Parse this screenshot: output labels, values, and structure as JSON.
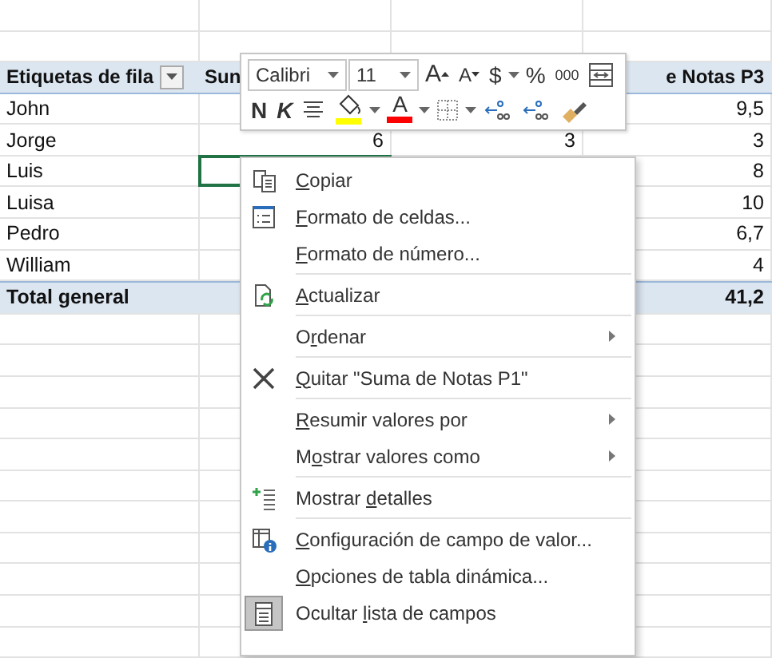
{
  "sheet": {
    "rows": [
      {
        "kind": "header",
        "label": "Etiquetas de fila",
        "filter": true,
        "column_2": "Sun",
        "column_4": "e Notas P3",
        "selected": false
      },
      {
        "kind": "item",
        "label": "John",
        "column_4": "9,5",
        "selected": false
      },
      {
        "kind": "item",
        "label": "Jorge",
        "column_2": "6",
        "column_3": "3",
        "column_4": "3",
        "selected": false
      },
      {
        "kind": "item",
        "label": "Luis",
        "column_4": "8",
        "selected": true
      },
      {
        "kind": "item",
        "label": "Luisa",
        "column_4": "10",
        "selected": false
      },
      {
        "kind": "item",
        "label": "Pedro",
        "column_4": "6,7",
        "selected": false
      },
      {
        "kind": "item",
        "label": "William",
        "column_4": "4",
        "selected": false
      },
      {
        "kind": "total",
        "label": "Total general",
        "column_4": "41,2",
        "selected": false
      }
    ]
  },
  "mini_toolbar": {
    "font": "Calibri",
    "size": "11",
    "row_1": [
      {
        "kind": "grow",
        "label": "A"
      },
      {
        "kind": "shrink",
        "label": "A"
      },
      {
        "kind": "text",
        "label": "$"
      },
      {
        "kind": "caret"
      },
      {
        "kind": "text",
        "label": "%"
      },
      {
        "kind": "small",
        "label": "000"
      },
      {
        "kind": "wrap"
      }
    ],
    "row_2": [
      {
        "kind": "bold",
        "label": "N"
      },
      {
        "kind": "italic",
        "label": "K"
      },
      {
        "kind": "align"
      },
      {
        "kind": "fill",
        "color": "#ffff00"
      },
      {
        "kind": "caret"
      },
      {
        "kind": "fontcolor",
        "label": "A",
        "color": "#ff0000"
      },
      {
        "kind": "caret"
      },
      {
        "kind": "borders"
      },
      {
        "kind": "caret"
      },
      {
        "kind": "more-decimals"
      },
      {
        "kind": "less-decimals"
      },
      {
        "kind": "brush"
      }
    ]
  },
  "context_menu": {
    "items": [
      {
        "kind": "copy",
        "key": "C",
        "post": "opiar",
        "submenu": false,
        "checked": false
      },
      {
        "kind": "format",
        "key": "F",
        "post": "ormato de celdas...",
        "submenu": false,
        "checked": false
      },
      {
        "kind": "plain",
        "key": "F",
        "post": "ormato de número...",
        "submenu": false,
        "checked": false
      },
      {
        "kind": "separator"
      },
      {
        "kind": "refresh",
        "key": "A",
        "post": "ctualizar",
        "submenu": false,
        "checked": false
      },
      {
        "kind": "separator"
      },
      {
        "kind": "plain",
        "pre": "O",
        "key": "r",
        "post": "denar",
        "submenu": true,
        "checked": false
      },
      {
        "kind": "separator"
      },
      {
        "kind": "remove",
        "key": "Q",
        "post": "uitar \"Suma de Notas P1\"",
        "submenu": false,
        "checked": false
      },
      {
        "kind": "separator"
      },
      {
        "kind": "plain",
        "key": "R",
        "post": "esumir valores por",
        "submenu": true,
        "checked": false
      },
      {
        "kind": "plain",
        "pre": "M",
        "key": "o",
        "post": "strar valores como",
        "submenu": true,
        "checked": false
      },
      {
        "kind": "separator"
      },
      {
        "kind": "details",
        "pre": "Mostrar ",
        "key": "d",
        "post": "etalles",
        "submenu": false,
        "checked": false
      },
      {
        "kind": "separator"
      },
      {
        "kind": "settings",
        "key": "C",
        "post": "onfiguración de campo de valor...",
        "submenu": false,
        "checked": false
      },
      {
        "kind": "plain",
        "key": "O",
        "post": "pciones de tabla dinámica...",
        "submenu": false,
        "checked": false
      },
      {
        "kind": "fieldlist",
        "pre": "Ocultar ",
        "key": "l",
        "post": "ista de campos",
        "submenu": false,
        "checked": true
      }
    ]
  }
}
